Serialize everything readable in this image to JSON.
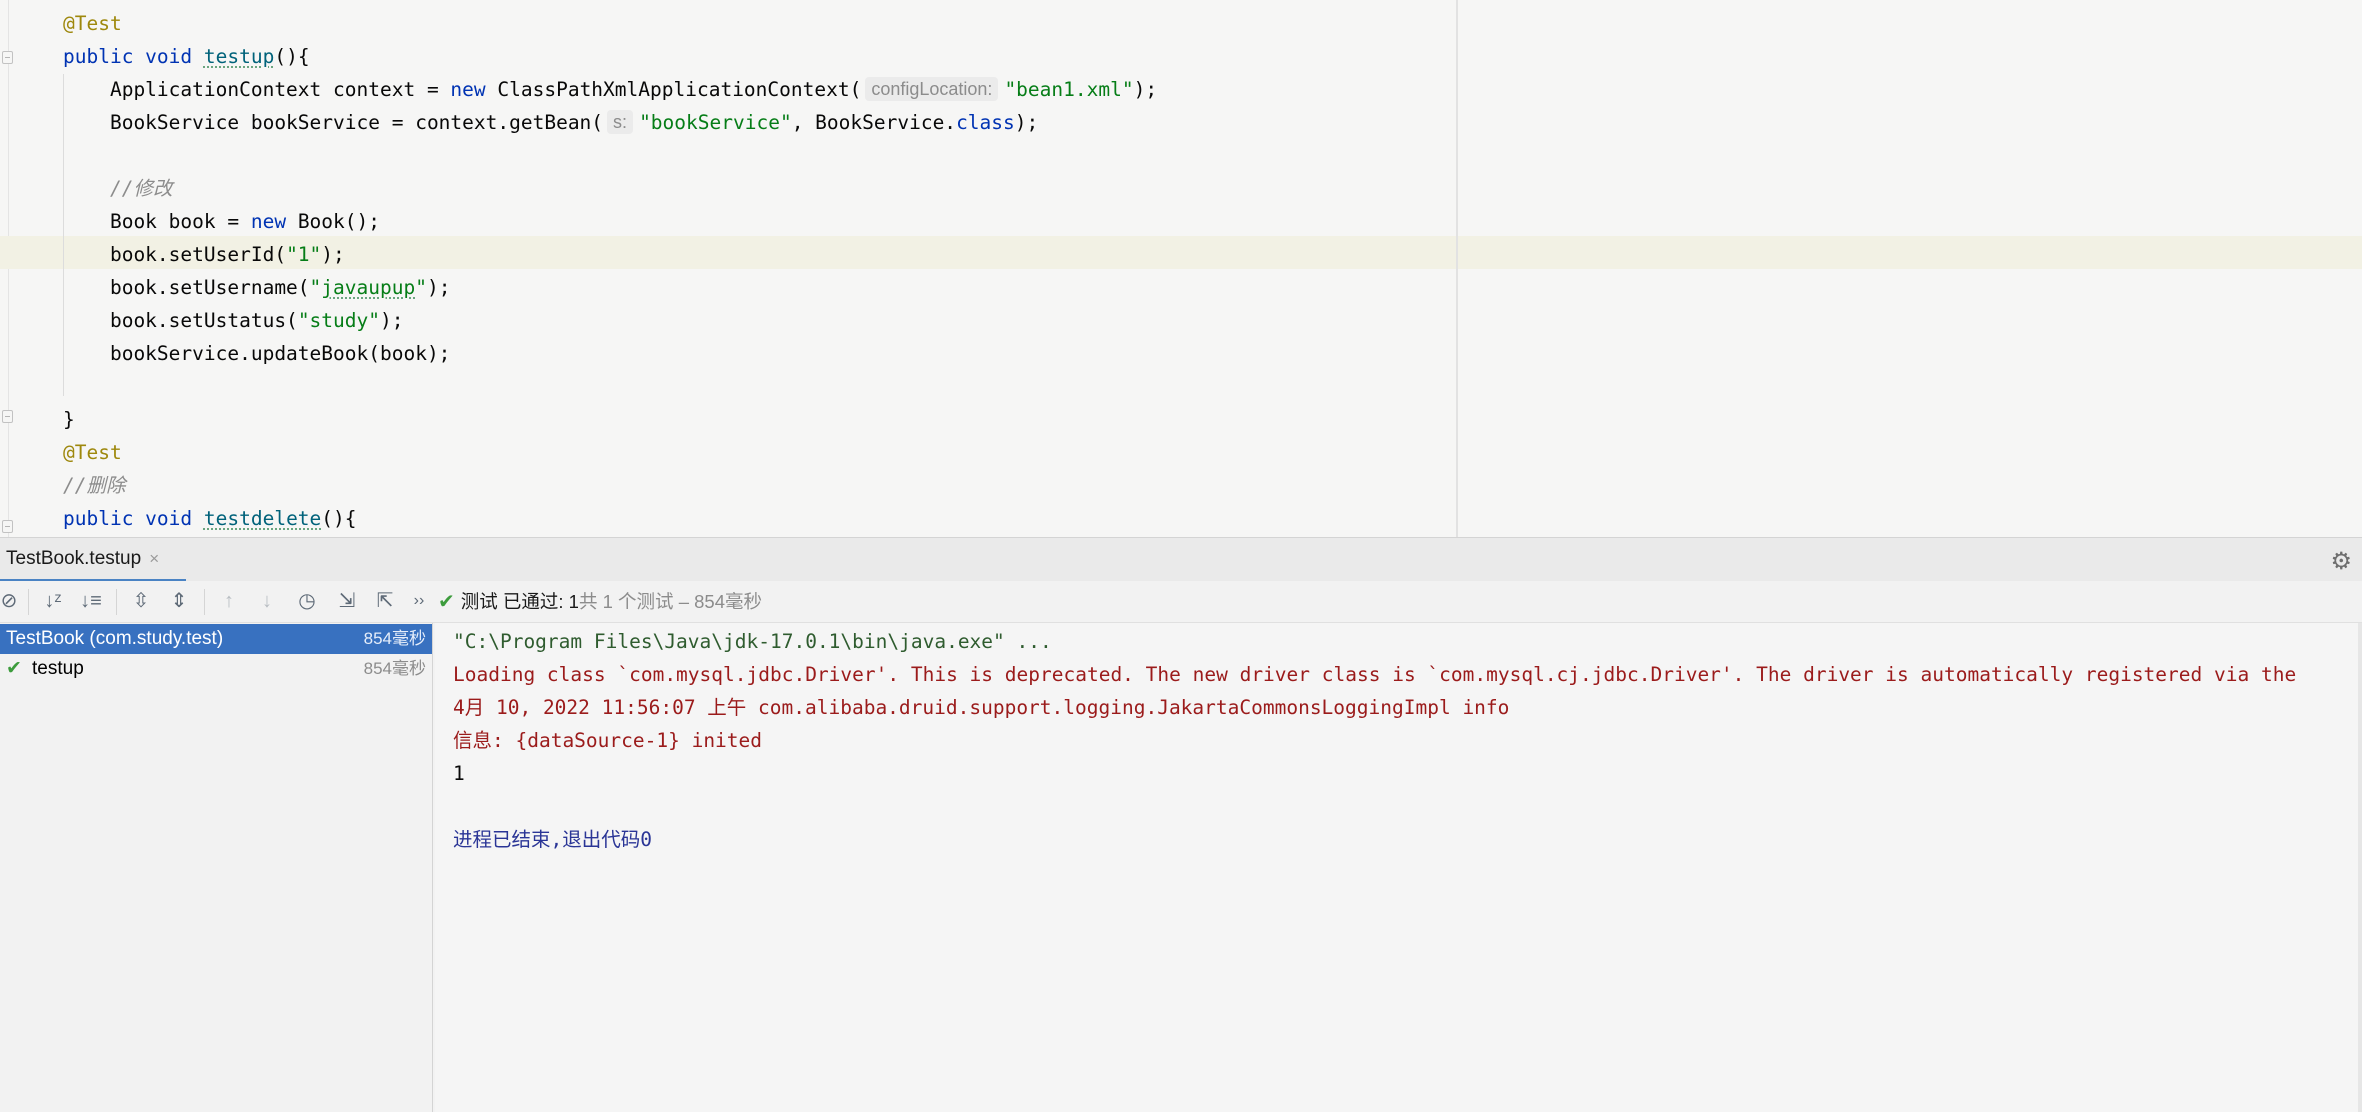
{
  "editor": {
    "lines": [
      [
        {
          "t": "@Test",
          "c": "ann"
        }
      ],
      [
        {
          "t": "public void ",
          "c": "kw"
        },
        {
          "t": "testup",
          "c": "method warn"
        },
        {
          "t": "(){"
        }
      ],
      [
        {
          "t": "    ApplicationContext context = "
        },
        {
          "t": "new ",
          "c": "kw"
        },
        {
          "t": "ClassPathXmlApplicationContext("
        },
        {
          "t": "configLocation:",
          "c": "hint"
        },
        {
          "t": "\"bean1.xml\"",
          "c": "str"
        },
        {
          "t": ");"
        }
      ],
      [
        {
          "t": "    BookService bookService = context.getBean("
        },
        {
          "t": "s:",
          "c": "hint"
        },
        {
          "t": "\"bookService\"",
          "c": "str"
        },
        {
          "t": ", BookService."
        },
        {
          "t": "class",
          "c": "kw"
        },
        {
          "t": ");"
        }
      ],
      [
        {
          "t": ""
        }
      ],
      [
        {
          "t": "    //修改",
          "c": "com"
        }
      ],
      [
        {
          "t": "    Book book = "
        },
        {
          "t": "new ",
          "c": "kw"
        },
        {
          "t": "Book();"
        }
      ],
      [
        {
          "t": "    book.setUserId("
        },
        {
          "t": "\"1\"",
          "c": "str"
        },
        {
          "t": ");"
        }
      ],
      [
        {
          "t": "    book.setUsername("
        },
        {
          "t": "\"",
          "c": "str"
        },
        {
          "t": "javaupup",
          "c": "str warn"
        },
        {
          "t": "\"",
          "c": "str"
        },
        {
          "t": ");"
        }
      ],
      [
        {
          "t": "    book.setUstatus("
        },
        {
          "t": "\"study\"",
          "c": "str"
        },
        {
          "t": ");"
        }
      ],
      [
        {
          "t": "    bookService.updateBook(book);"
        }
      ],
      [
        {
          "t": ""
        }
      ],
      [
        {
          "t": "}"
        }
      ],
      [
        {
          "t": "@Test",
          "c": "ann"
        }
      ],
      [
        {
          "t": "//删除",
          "c": "com"
        }
      ],
      [
        {
          "t": "public void ",
          "c": "kw"
        },
        {
          "t": "testdelete",
          "c": "method warn"
        },
        {
          "t": "(){"
        }
      ]
    ]
  },
  "run_panel": {
    "tab_label": "TestBook.testup",
    "tab_close": "×",
    "status_main": "测试 已通过: 1",
    "status_detail": "共 1 个测试 – 854毫秒",
    "overflow_label": "››",
    "tree": {
      "root_name": "TestBook (com.study.test)",
      "root_time": "854毫秒",
      "child_name": "testup",
      "child_time": "854毫秒"
    },
    "console": [
      {
        "text": "\"C:\\Program Files\\Java\\jdk-17.0.1\\bin\\java.exe\" ...",
        "kind": "cmd"
      },
      {
        "text": "Loading class `com.mysql.jdbc.Driver'. This is deprecated. The new driver class is `com.mysql.cj.jdbc.Driver'. The driver is automatically registered via the",
        "kind": "err"
      },
      {
        "text": "4月 10, 2022 11:56:07 上午 com.alibaba.druid.support.logging.JakartaCommonsLoggingImpl info",
        "kind": "err"
      },
      {
        "text": "信息: {dataSource-1} inited",
        "kind": "err"
      },
      {
        "text": "1",
        "kind": "out"
      },
      {
        "text": "",
        "kind": "out"
      },
      {
        "text": "进程已结束,退出代码0",
        "kind": "exit"
      }
    ]
  },
  "icons": {
    "stop": "⊘",
    "sort_alpha": "↓ᶻ",
    "sort_duration": "↓≡",
    "expand_all": "⇳",
    "collapse_all": "⇕",
    "prev_failed": "↑",
    "next_failed": "↓",
    "history": "◷",
    "import": "⇲",
    "export": "⇱",
    "passed_check": "✔",
    "settings": "⚙"
  }
}
